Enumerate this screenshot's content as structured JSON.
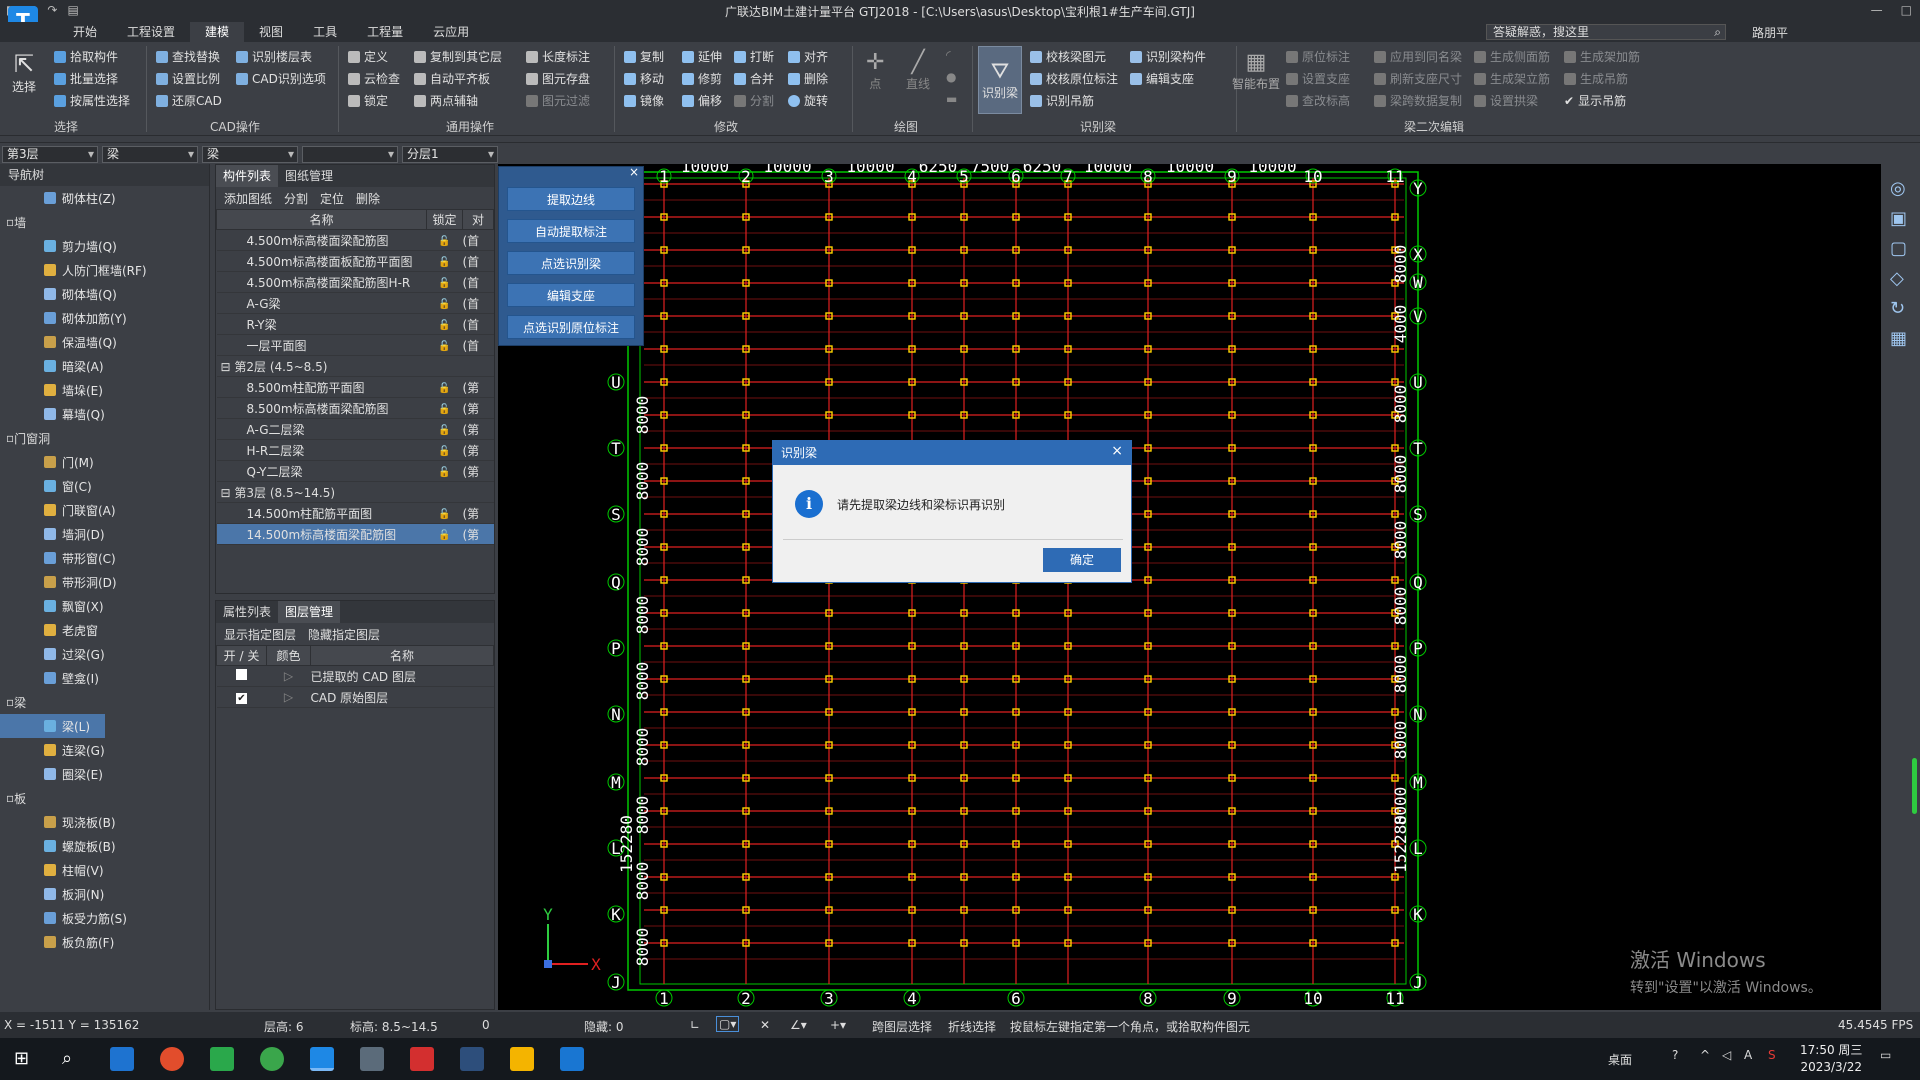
{
  "window": {
    "title": "广联达BIM土建计量平台 GTJ2018 - [C:\\Users\\asus\\Desktop\\宝利根1#生产车间.GTJ]"
  },
  "menu": [
    "开始",
    "工程设置",
    "建模",
    "视图",
    "工具",
    "工程量",
    "云应用"
  ],
  "search": {
    "label": "答疑解惑，搜这里",
    "user": "路朋平"
  },
  "ribbon": {
    "select": {
      "big": "选择",
      "group": "选择",
      "items": [
        "拾取构件",
        "批量选择",
        "按属性选择"
      ]
    },
    "cad": {
      "group": "CAD操作",
      "items": [
        "查找替换",
        "设置比例",
        "还原CAD",
        "识别楼层表",
        "CAD识别选项"
      ]
    },
    "general": {
      "group": "通用操作",
      "items": [
        "定义",
        "复制到其它层",
        "长度标注",
        "云检查",
        "自动平齐板",
        "图元存盘",
        "锁定",
        "两点辅轴",
        "图元过滤"
      ]
    },
    "modify": {
      "group": "修改",
      "items": [
        "复制",
        "延伸",
        "打断",
        "对齐",
        "移动",
        "修剪",
        "合并",
        "删除",
        "镜像",
        "偏移",
        "分割",
        "旋转"
      ]
    },
    "draw": {
      "group": "绘图",
      "items": [
        "点",
        "直线"
      ]
    },
    "recog": {
      "group": "识别梁",
      "big": "识别梁",
      "items": [
        "校核梁图元",
        "识别梁构件",
        "校核原位标注",
        "编辑支座",
        "识别吊筋"
      ]
    },
    "second": {
      "group": "梁二次编辑",
      "big": "智能布置",
      "items": [
        "原位标注",
        "应用到同名梁",
        "生成侧面筋",
        "生成架加筋",
        "设置支座",
        "刷新支座尺寸",
        "生成架立筋",
        "生成吊筋",
        "查改标高",
        "梁跨数据复制",
        "设置拱梁",
        "显示吊筋"
      ]
    }
  },
  "selectors": [
    "第3层",
    "梁",
    "梁",
    "",
    "分层1"
  ],
  "nav": {
    "title": "导航树",
    "rows": [
      {
        "label": "砌体柱(Z)",
        "cat": false
      },
      {
        "label": "墙",
        "cat": true
      },
      {
        "label": "剪力墙(Q)",
        "cat": false
      },
      {
        "label": "人防门框墙(RF)",
        "cat": false
      },
      {
        "label": "砌体墙(Q)",
        "cat": false
      },
      {
        "label": "砌体加筋(Y)",
        "cat": false
      },
      {
        "label": "保温墙(Q)",
        "cat": false
      },
      {
        "label": "暗梁(A)",
        "cat": false
      },
      {
        "label": "墙垛(E)",
        "cat": false
      },
      {
        "label": "幕墙(Q)",
        "cat": false
      },
      {
        "label": "门窗洞",
        "cat": true
      },
      {
        "label": "门(M)",
        "cat": false
      },
      {
        "label": "窗(C)",
        "cat": false
      },
      {
        "label": "门联窗(A)",
        "cat": false
      },
      {
        "label": "墙洞(D)",
        "cat": false
      },
      {
        "label": "带形窗(C)",
        "cat": false
      },
      {
        "label": "带形洞(D)",
        "cat": false
      },
      {
        "label": "飘窗(X)",
        "cat": false
      },
      {
        "label": "老虎窗",
        "cat": false
      },
      {
        "label": "过梁(G)",
        "cat": false
      },
      {
        "label": "壁龛(I)",
        "cat": false
      },
      {
        "label": "梁",
        "cat": true
      },
      {
        "label": "梁(L)",
        "cat": false,
        "selected": true
      },
      {
        "label": "连梁(G)",
        "cat": false
      },
      {
        "label": "圈梁(E)",
        "cat": false
      },
      {
        "label": "板",
        "cat": true
      },
      {
        "label": "现浇板(B)",
        "cat": false
      },
      {
        "label": "螺旋板(B)",
        "cat": false
      },
      {
        "label": "柱帽(V)",
        "cat": false
      },
      {
        "label": "板洞(N)",
        "cat": false
      },
      {
        "label": "板受力筋(S)",
        "cat": false
      },
      {
        "label": "板负筋(F)",
        "cat": false
      }
    ]
  },
  "components": {
    "tabs": [
      "构件列表",
      "图纸管理"
    ],
    "tools": [
      "添加图纸",
      "分割",
      "定位",
      "删除"
    ],
    "cols": [
      "名称",
      "锁定",
      "对"
    ],
    "rows": [
      {
        "name": "4.500m标高楼面梁配筋图",
        "grp": false,
        "c": "(首"
      },
      {
        "name": "4.500m标高楼面板配筋平面图",
        "grp": false,
        "c": "(首"
      },
      {
        "name": "4.500m标高楼面梁配筋图H-R",
        "grp": false,
        "c": "(首"
      },
      {
        "name": "A-G梁",
        "grp": false,
        "c": "(首"
      },
      {
        "name": "R-Y梁",
        "grp": false,
        "c": "(首"
      },
      {
        "name": "一层平面图",
        "grp": false,
        "c": "(首"
      },
      {
        "name": "第2层 (4.5~8.5)",
        "grp": true,
        "c": ""
      },
      {
        "name": "8.500m柱配筋平面图",
        "grp": false,
        "c": "(第"
      },
      {
        "name": "8.500m标高楼面梁配筋图",
        "grp": false,
        "c": "(第"
      },
      {
        "name": "A-G二层梁",
        "grp": false,
        "c": "(第"
      },
      {
        "name": "H-R二层梁",
        "grp": false,
        "c": "(第"
      },
      {
        "name": "Q-Y二层梁",
        "grp": false,
        "c": "(第"
      },
      {
        "name": "第3层 (8.5~14.5)",
        "grp": true,
        "c": ""
      },
      {
        "name": "14.500m柱配筋平面图",
        "grp": false,
        "c": "(第"
      },
      {
        "name": "14.500m标高楼面梁配筋图",
        "grp": false,
        "c": "(第",
        "hl": true
      }
    ]
  },
  "props": {
    "tabs": [
      "属性列表",
      "图层管理"
    ],
    "tools": [
      "显示指定图层",
      "隐藏指定图层"
    ],
    "cols": [
      "开 / 关",
      "颜色",
      "名称"
    ],
    "rows": [
      {
        "name": "已提取的 CAD 图层",
        "on": false
      },
      {
        "name": "CAD 原始图层",
        "on": true
      }
    ]
  },
  "floatpanel": {
    "buttons": [
      "提取边线",
      "自动提取标注",
      "点选识别梁",
      "编辑支座",
      "点选识别原位标注"
    ]
  },
  "canvas": {
    "top_dims": [
      "10000",
      "10000",
      "10000",
      "6250",
      "7500",
      "6250",
      "10000",
      "10000",
      "10000"
    ],
    "top_axes": [
      "1",
      "2",
      "3",
      "4",
      "5",
      "6",
      "7",
      "8",
      "9",
      "10",
      "11"
    ],
    "bottom_axes": [
      "1",
      "2",
      "3",
      "4",
      "6",
      "8",
      "9",
      "10",
      "11"
    ],
    "left_axes": [
      "U",
      "T",
      "S",
      "Q",
      "P",
      "N",
      "M",
      "L",
      "K",
      "J"
    ],
    "right_axes": [
      "Y",
      "X",
      "W",
      "V",
      "U",
      "T",
      "S",
      "Q",
      "P",
      "N",
      "M",
      "L",
      "K",
      "J"
    ],
    "left_dims": [
      "8000",
      "8000",
      "8000",
      "8000",
      "8000",
      "8000",
      "8000",
      "8000",
      "8000"
    ],
    "left_total": "152280",
    "right_dims": [
      "8000",
      "4000",
      "8000",
      "8000",
      "8000",
      "8000",
      "8000",
      "8000",
      "8000"
    ],
    "right_total": "152280",
    "axis_x": "X",
    "axis_y": "Y"
  },
  "dialog": {
    "title": "识别梁",
    "message": "请先提取梁边线和梁标识再识别",
    "ok": "确定"
  },
  "status": {
    "coords": "X = -1511 Y = 135162",
    "floor_h": "层高:  6",
    "elev": "标高:  8.5~14.5",
    "zero": "0",
    "hidden": "隐藏:  0",
    "s1": "跨图层选择",
    "s2": "折线选择",
    "hint": "按鼠标左键指定第一个角点，或拾取构件图元",
    "fps": "45.4545 FPS"
  },
  "watermark": {
    "line1": "激活 Windows",
    "line2": "转到\"设置\"以激活 Windows。"
  },
  "taskbar": {
    "desktop": "桌面",
    "time": "17:50 周三",
    "date": "2023/3/22"
  },
  "colors": {
    "accent": "#2e6bb5",
    "axis": "#00c800",
    "beam": "#e02020",
    "node": "#ffd400"
  }
}
